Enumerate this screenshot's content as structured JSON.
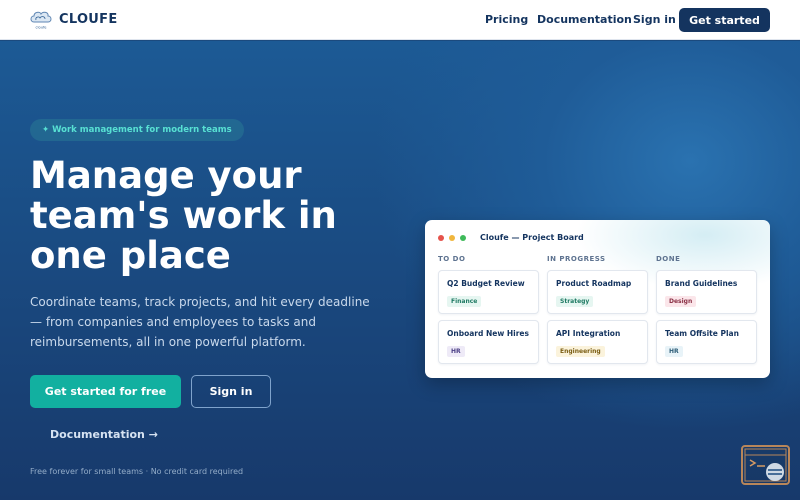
{
  "brand": {
    "name": "CLOUFE",
    "logo_caption": "cloufe"
  },
  "nav": {
    "links": [
      "Pricing",
      "Documentation",
      "Sign in"
    ],
    "cta": "Get started"
  },
  "hero": {
    "eyebrow": "✦ Work management for modern teams",
    "headline": [
      "Manage your",
      "team's work in",
      "one place"
    ],
    "subtext": [
      "Coordinate teams, track projects, and hit every deadline",
      "— from companies and employees to tasks and",
      "reimbursements, all in one powerful platform."
    ],
    "primary_cta": "Get started for free",
    "secondary_cta": "Sign in",
    "doc_link": "Documentation →",
    "footnote": "Free forever for small teams · No credit card required"
  },
  "board": {
    "title": "Cloufe — Project Board",
    "window_dots": [
      "#e5534b",
      "#f0b63d",
      "#3fba5a"
    ],
    "columns": [
      {
        "label": "TO DO",
        "tasks": [
          {
            "name": "Q2 Budget Review",
            "tag": "Finance",
            "tag_color": "#e6f6f1",
            "tag_text": "#1f7a63"
          },
          {
            "name": "Onboard New Hires",
            "tag": "HR",
            "tag_color": "#eeeaf7",
            "tag_text": "#4b3f86"
          }
        ]
      },
      {
        "label": "IN PROGRESS",
        "tasks": [
          {
            "name": "Product Roadmap",
            "tag": "Strategy",
            "tag_color": "#e6f6f1",
            "tag_text": "#1f7a63"
          },
          {
            "name": "API Integration",
            "tag": "Engineering",
            "tag_color": "#fbf3dc",
            "tag_text": "#7a5d12"
          }
        ]
      },
      {
        "label": "DONE",
        "tasks": [
          {
            "name": "Brand Guidelines",
            "tag": "Design",
            "tag_color": "#fbe6ea",
            "tag_text": "#8a2f44"
          },
          {
            "name": "Team Offsite Plan",
            "tag": "HR",
            "tag_color": "#e8f3f8",
            "tag_text": "#2e5e78"
          }
        ]
      }
    ]
  },
  "colors": {
    "brand_navy": "#14345f",
    "accent_teal": "#12b0a0",
    "hero_blue": "#1b4a7e"
  }
}
